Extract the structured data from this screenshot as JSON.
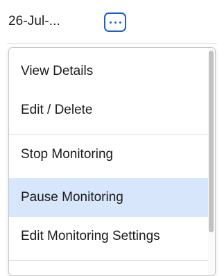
{
  "row": {
    "date_text": "26-Jul-...",
    "more_button_icon": "more-horizontal-icon",
    "accent_color": "#1b5ec9"
  },
  "menu": {
    "items": [
      {
        "label": "View Details",
        "highlighted": false
      },
      {
        "label": "Edit / Delete",
        "highlighted": false
      },
      {
        "label": "Stop Monitoring",
        "highlighted": false
      },
      {
        "label": "Pause Monitoring",
        "highlighted": true
      },
      {
        "label": "Edit Monitoring Settings",
        "highlighted": false
      }
    ],
    "highlight_color": "#d7e6fb"
  }
}
